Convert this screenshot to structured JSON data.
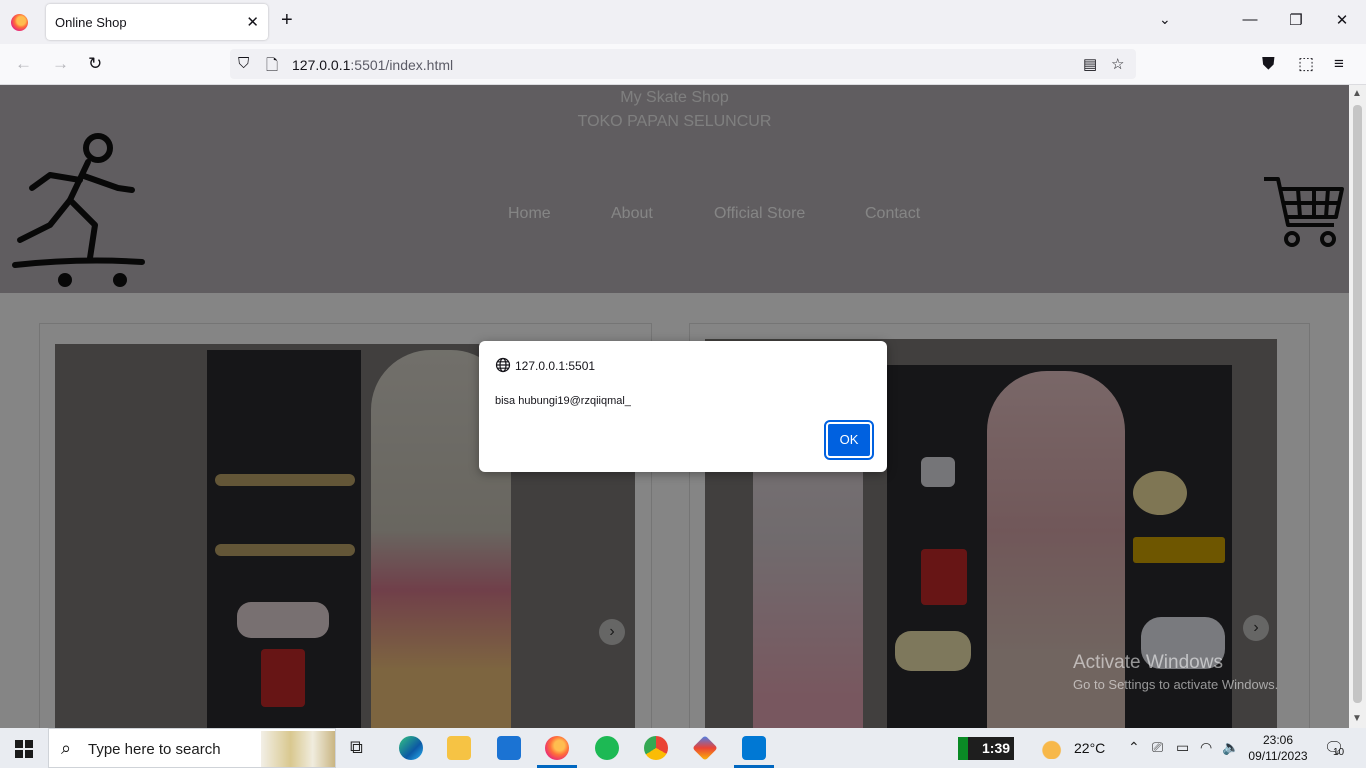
{
  "browser": {
    "tab_title": "Online Shop",
    "tab_close": "✕",
    "new_tab": "+",
    "url_host": "127.0.0.1",
    "url_rest": ":5501/index.html"
  },
  "site": {
    "title": "My Skate Shop",
    "subtitle": "TOKO PAPAN SELUNCUR",
    "nav": [
      "Home",
      "About",
      "Official Store",
      "Contact"
    ]
  },
  "dialog": {
    "origin": "127.0.0.1:5501",
    "message": "bisa hubungi19@rzqiiqmal_",
    "ok_label": "OK"
  },
  "watermark": {
    "line1": "Activate Windows",
    "line2": "Go to Settings to activate Windows."
  },
  "taskbar": {
    "search_placeholder": "Type here to search",
    "timer": "1:39",
    "weather": "22°C",
    "time": "23:06",
    "date": "09/11/2023",
    "notifications": "10"
  },
  "colors": {
    "header_bg": "#b9b3b9",
    "dialog_button": "#0061e0",
    "overlay": "rgba(0,0,0,0.48)"
  }
}
